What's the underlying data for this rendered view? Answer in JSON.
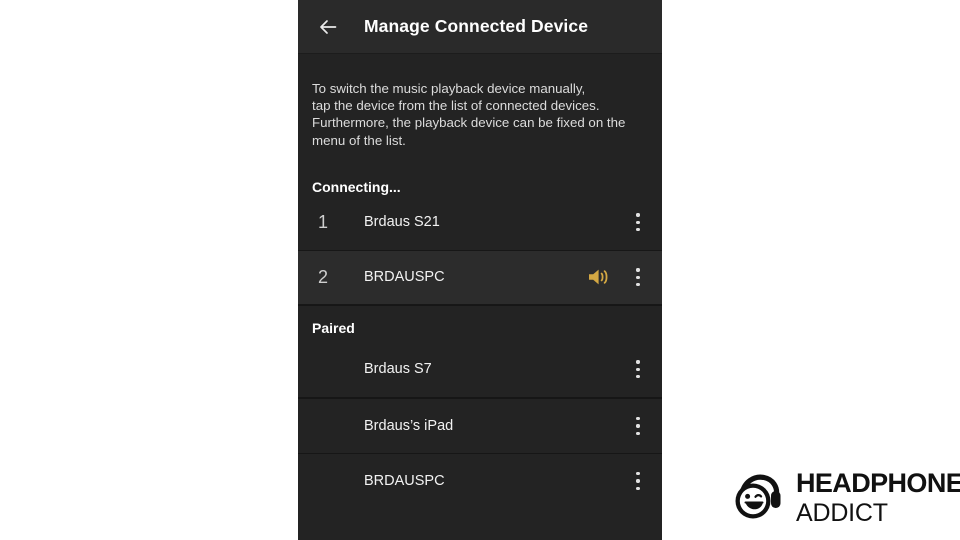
{
  "colors": {
    "page_background": "#ffffff",
    "panel_background": "#232323",
    "app_bar_background": "#2a2a2a",
    "highlight_row_background": "#2c2c2c",
    "accent_speaker": "#d4a843",
    "primary_text": "#ffffff",
    "body_text": "#dcdcdc",
    "brand_text": "#111111"
  },
  "app_bar": {
    "back_icon": "arrow-left-icon",
    "title": "Manage Connected Device"
  },
  "description": "To switch the music playback device manually,\ntap the device from the list of connected devices.\nFurthermore, the playback device can be fixed on the\nmenu of the list.",
  "sections": [
    {
      "id": "connecting",
      "header": "Connecting...",
      "devices": [
        {
          "index": "1",
          "name": "Brdaus S21",
          "active_speaker": false,
          "highlighted": false,
          "menu_icon": "kebab-menu-icon"
        },
        {
          "index": "2",
          "name": "BRDAUSPC",
          "active_speaker": true,
          "speaker_icon": "speaker-volume-icon",
          "highlighted": true,
          "menu_icon": "kebab-menu-icon"
        }
      ]
    },
    {
      "id": "paired",
      "header": "Paired",
      "devices": [
        {
          "index": "",
          "name": "Brdaus S7",
          "active_speaker": false,
          "highlighted": false,
          "menu_icon": "kebab-menu-icon"
        },
        {
          "index": "",
          "name": "Brdaus’s iPad",
          "active_speaker": false,
          "highlighted": false,
          "menu_icon": "kebab-menu-icon"
        },
        {
          "index": "",
          "name": "BRDAUSPC",
          "active_speaker": false,
          "highlighted": false,
          "menu_icon": "kebab-menu-icon"
        }
      ]
    }
  ],
  "brand": {
    "mark_icon": "headphones-smiley-logo-icon",
    "line1": "HEADPHONES",
    "line2": "ADDICT"
  }
}
